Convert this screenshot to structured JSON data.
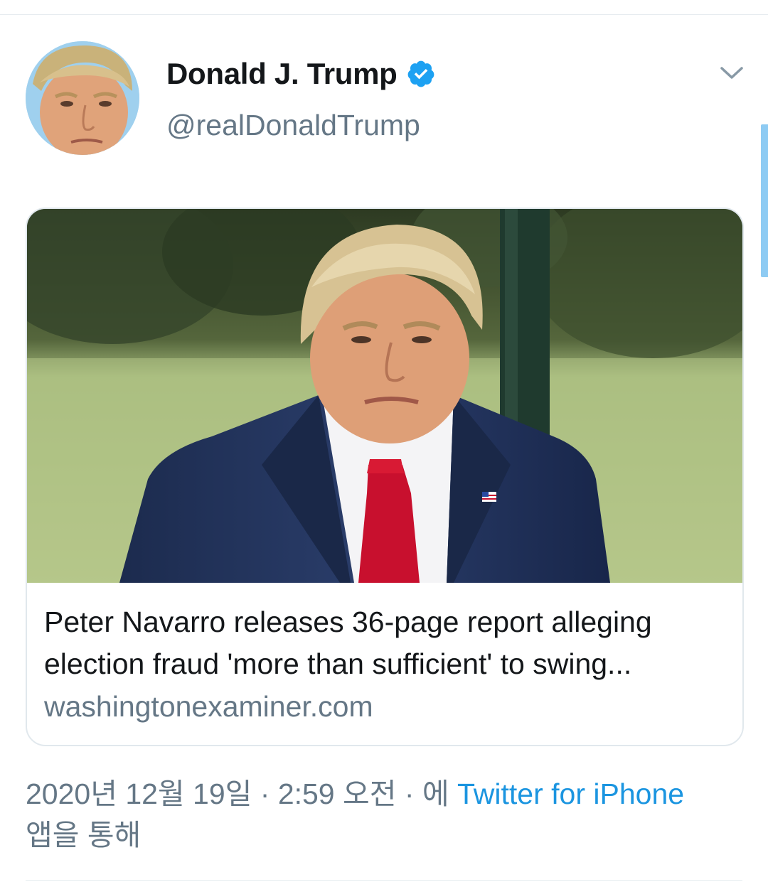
{
  "tweet": {
    "author": {
      "display_name": "Donald J. Trump",
      "handle": "@realDonaldTrump",
      "verified": true
    },
    "card": {
      "title": "Peter Navarro releases 36-page report alleging election fraud 'more than sufficient' to swing...",
      "domain": "washingtonexaminer.com"
    },
    "meta": {
      "date": "2020년 12월 19일",
      "separator": " · ",
      "time": "2:59 오전",
      "via_prefix": "에 ",
      "source": "Twitter for iPhone",
      "via_suffix": "앱을 통해"
    }
  },
  "colors": {
    "accent": "#1b95e0",
    "verified_badge": "#1da1f2",
    "secondary_text": "#657786",
    "primary_text": "#14171a",
    "border": "#e1e8ed"
  },
  "icons": {
    "verified": "verified-badge-icon",
    "menu": "chevron-down-icon"
  }
}
